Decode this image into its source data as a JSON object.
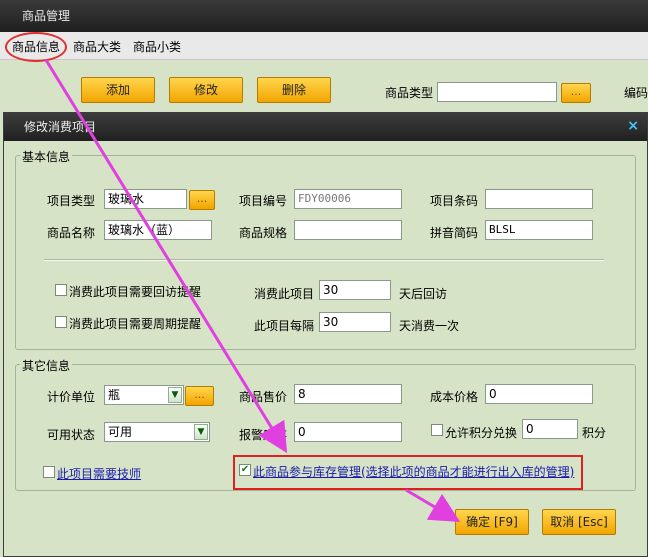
{
  "parent": {
    "title": "商品管理",
    "tabs": [
      "商品信息",
      "商品大类",
      "商品小类"
    ],
    "toolbar": {
      "add": "添加",
      "edit": "修改",
      "delete": "删除"
    },
    "filter_label": "商品类型",
    "filter_dots": "...",
    "code_label": "编码"
  },
  "dialog": {
    "title": "修改消费项目",
    "close": "×",
    "basic": {
      "title": "基本信息",
      "type_label": "项目类型",
      "type_value": "玻璃水",
      "type_dots": "...",
      "code_label": "项目编号",
      "code_value": "FDY00006",
      "barcode_label": "项目条码",
      "barcode_value": "",
      "name_label": "商品名称",
      "name_value": "玻璃水（蓝）",
      "spec_label": "商品规格",
      "spec_value": "",
      "pinyin_label": "拼音简码",
      "pinyin_value": "BLSL",
      "revisit_check": "消费此项目需要回访提醒",
      "revisit_prefix": "消费此项目",
      "revisit_days": "30",
      "revisit_suffix": "天后回访",
      "cycle_check": "消费此项目需要周期提醒",
      "cycle_prefix": "此项目每隔",
      "cycle_days": "30",
      "cycle_suffix": "天消费一次"
    },
    "other": {
      "title": "其它信息",
      "unit_label": "计价单位",
      "unit_value": "瓶",
      "unit_dots": "...",
      "price_label": "商品售价",
      "price_value": "8",
      "cost_label": "成本价格",
      "cost_value": "0",
      "status_label": "可用状态",
      "status_value": "可用",
      "alarm_label": "报警库存",
      "alarm_value": "0",
      "points_check": "允许积分兑换",
      "points_value": "0",
      "points_suffix": "积分",
      "tech_check": "此项目需要技师",
      "stock_check": "此商品参与库存管理(选择此项的商品才能进行出入库的管理)",
      "stock_checked": true
    },
    "buttons": {
      "ok": "确定 [F9]",
      "cancel": "取消 [Esc]"
    }
  },
  "colors": {
    "accent_orange": "#f2a400",
    "highlight_red": "#e02020",
    "arrow_magenta": "#e040e0",
    "panel_green": "#d7e3c7"
  }
}
